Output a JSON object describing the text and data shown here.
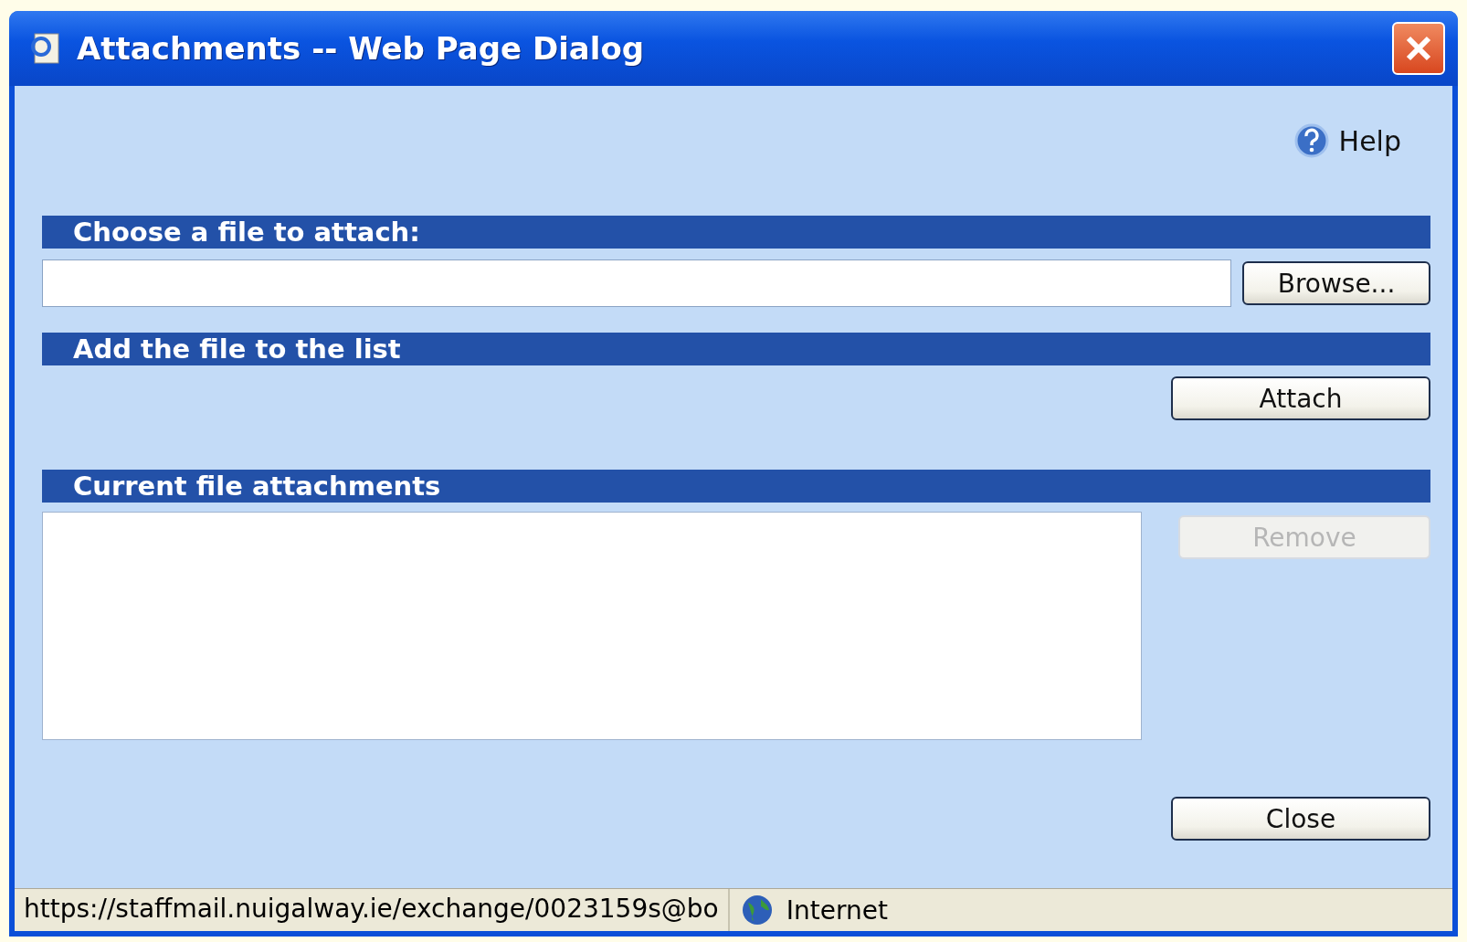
{
  "window": {
    "title": "Attachments -- Web Page Dialog"
  },
  "help": {
    "label": "Help"
  },
  "sections": [
    {
      "heading": "Choose a file to attach:",
      "kind": "file"
    },
    {
      "heading": "Add the file to the list",
      "kind": "attach"
    },
    {
      "heading": "Current file attachments",
      "kind": "list"
    }
  ],
  "browse_button": {
    "label": "Browse...",
    "disabled": false
  },
  "attach_button": {
    "label": "Attach",
    "disabled": false
  },
  "remove_button": {
    "label": "Remove",
    "disabled": true
  },
  "close_button": {
    "label": "Close",
    "disabled": false
  },
  "status_bar": {
    "url": "https://staffmail.nuigalway.ie/exchange/0023159s@bo",
    "zone": "Internet"
  }
}
